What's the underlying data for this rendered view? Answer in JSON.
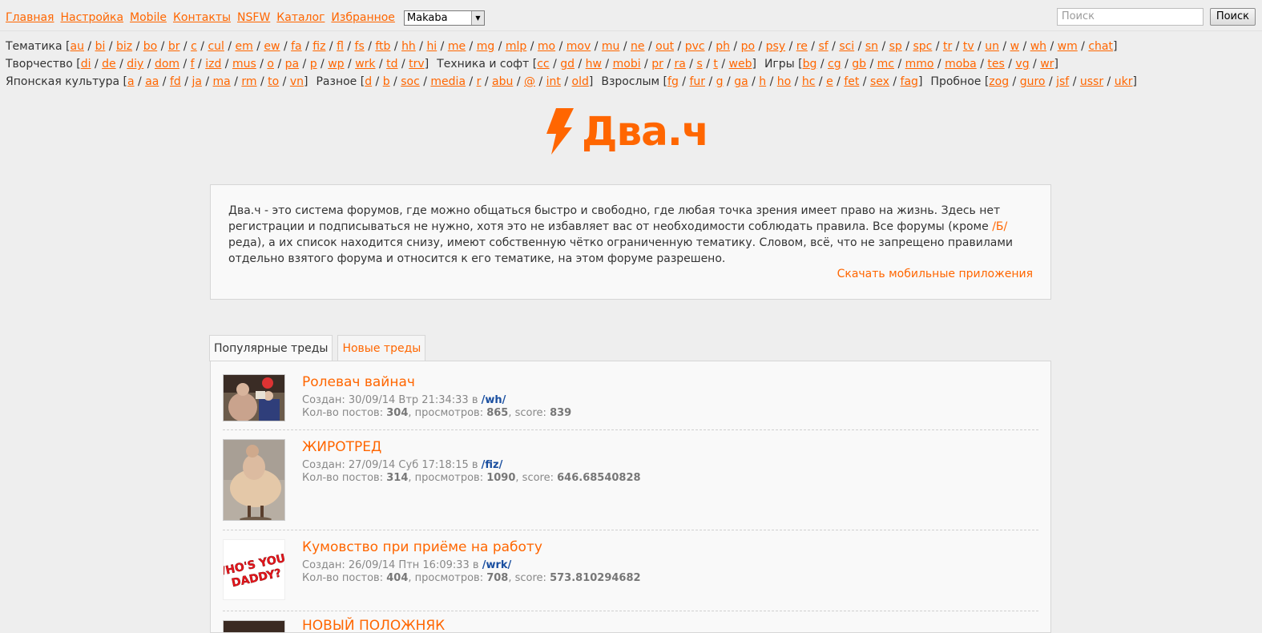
{
  "topnav": [
    "Главная",
    "Настройка",
    "Mobile",
    "Контакты",
    "NSFW",
    "Каталог",
    "Избранное"
  ],
  "style_select": {
    "value": "Makaba"
  },
  "search": {
    "placeholder": "Поиск",
    "button": "Поиск"
  },
  "boards": {
    "line1": [
      {
        "name": "Тематика",
        "boards": [
          "au",
          "bi",
          "biz",
          "bo",
          "br",
          "c",
          "cul",
          "em",
          "ew",
          "fa",
          "fiz",
          "fl",
          "fs",
          "ftb",
          "hh",
          "hi",
          "me",
          "mg",
          "mlp",
          "mo",
          "mov",
          "mu",
          "ne",
          "out",
          "pvc",
          "ph",
          "po",
          "psy",
          "re",
          "sf",
          "sci",
          "sn",
          "sp",
          "spc",
          "tr",
          "tv",
          "un",
          "w",
          "wh",
          "wm",
          "chat"
        ]
      }
    ],
    "line2": [
      {
        "name": "Творчество",
        "boards": [
          "di",
          "de",
          "diy",
          "dom",
          "f",
          "izd",
          "mus",
          "o",
          "pa",
          "p",
          "wp",
          "wrk",
          "td",
          "trv"
        ]
      },
      {
        "name": "Техника и софт",
        "boards": [
          "cc",
          "gd",
          "hw",
          "mobi",
          "pr",
          "ra",
          "s",
          "t",
          "web"
        ]
      },
      {
        "name": "Игры",
        "boards": [
          "bg",
          "cg",
          "gb",
          "mc",
          "mmo",
          "moba",
          "tes",
          "vg",
          "wr"
        ]
      }
    ],
    "line3": [
      {
        "name": "Японская культура",
        "boards": [
          "a",
          "aa",
          "fd",
          "ja",
          "ma",
          "rm",
          "to",
          "vn"
        ]
      },
      {
        "name": "Разное",
        "boards": [
          "d",
          "b",
          "soc",
          "media",
          "r",
          "abu",
          "@",
          "int",
          "old"
        ]
      },
      {
        "name": "Взрослым",
        "boards": [
          "fg",
          "fur",
          "g",
          "ga",
          "h",
          "ho",
          "hc",
          "e",
          "fet",
          "sex",
          "fag"
        ]
      },
      {
        "name": "Пробное",
        "boards": [
          "zog",
          "guro",
          "jsf",
          "ussr",
          "ukr"
        ]
      }
    ]
  },
  "logo": {
    "text": "Два.ч",
    "color": "#ff6600"
  },
  "about": {
    "text_before": "Два.ч - это система форумов, где можно общаться быстро и свободно, где любая точка зрения имеет право на жизнь. Здесь нет регистрации и подписываться не нужно, хотя это не избавляет вас от необходимости соблюдать правила. Все форумы (кроме ",
    "inline_link": "/Б/",
    "text_after": "реда), а их список находится снизу, имеют собственную чётко ограниченную тематику. Словом, всё, что не запрещено правилами отдельно взятого форума и относится к его тематике, на этом форуме разрешено.",
    "mobile_link": "Скачать мобильные приложения"
  },
  "tabs": [
    {
      "label": "Популярные треды",
      "active": true
    },
    {
      "label": "Новые треды",
      "active": false
    }
  ],
  "threads": [
    {
      "title": "Ролевач вайнач",
      "created": "Создан: 30/09/14 Втр 21:34:33 в ",
      "board": "/wh/",
      "posts_label": "Кол-во постов: ",
      "posts": "304",
      "views_label": ", просмотров: ",
      "views": "865",
      "score_label": ", score: ",
      "score": "839"
    },
    {
      "title": "ЖИРОТРЕД",
      "created": "Создан: 27/09/14 Суб 17:18:15 в ",
      "board": "/fiz/",
      "posts_label": "Кол-во постов: ",
      "posts": "314",
      "views_label": ", просмотров: ",
      "views": "1090",
      "score_label": ", score: ",
      "score": "646.68540828"
    },
    {
      "title": "Кумовство при приёме на работу",
      "created": "Создан: 26/09/14 Птн 16:09:33 в ",
      "board": "/wrk/",
      "posts_label": "Кол-во постов: ",
      "posts": "404",
      "views_label": ", просмотров: ",
      "views": "708",
      "score_label": ", score: ",
      "score": "573.810294682"
    },
    {
      "title": "НОВЫЙ ПОЛОЖНЯК"
    }
  ],
  "thumb3_text": "WHO'S YOUR DADDY?"
}
